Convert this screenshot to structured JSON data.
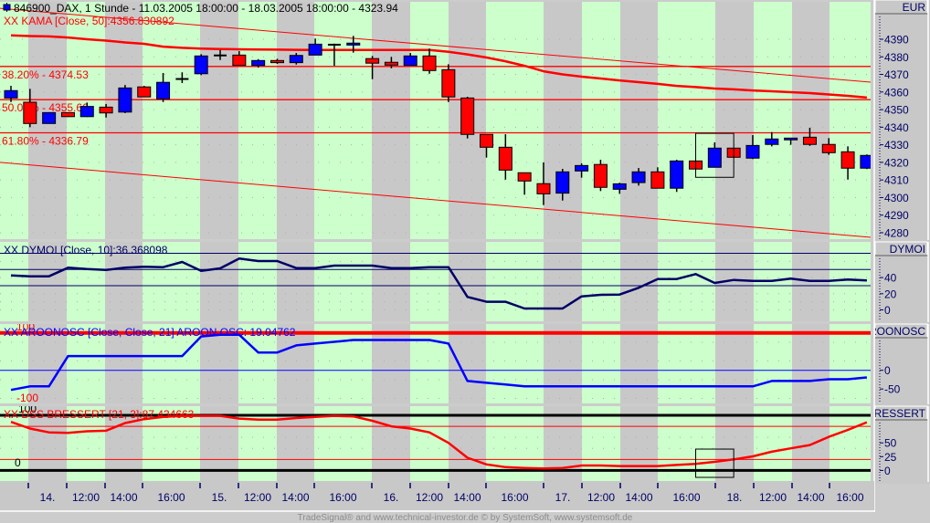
{
  "header": {
    "title": "846900_DAX, 1 Stunde - 11.03.2005 18:00:00 - 18.03.2005 18:00:00 - 4323.94",
    "icon": "candlestick-square-icon"
  },
  "footer": "TradeSignal® and www.technical-investor.de © by SystemSoft, www.systemsoft.de",
  "colors": {
    "up": "#0000ff",
    "down": "#ff0000",
    "doji": "#000000",
    "band_green": "#ccffcc",
    "band_gray": "#c8c8c8",
    "axis_text": "#000066",
    "kama": "#ff0000",
    "dymoi": "#000066",
    "aroon": "#0000ff",
    "dss": "#ff0000"
  },
  "x_axis": {
    "tick_labels": [
      "14.",
      "12:00",
      "14:00",
      "16:00",
      "15.",
      "12:00",
      "14:00",
      "16:00",
      "16.",
      "12:00",
      "14:00",
      "16:00",
      "17.",
      "12:00",
      "14:00",
      "16:00",
      "18.",
      "12:00",
      "14:00",
      "16:00"
    ]
  },
  "chart_data": [
    {
      "type": "candlestick",
      "axis_label": "EUR",
      "yticks": [
        4390,
        4380,
        4370,
        4360,
        4350,
        4340,
        4330,
        4320,
        4310,
        4300,
        4290,
        4280
      ],
      "ylim": [
        4270,
        4415
      ],
      "open": [
        4356.6,
        4354.2,
        4342.1,
        4348.3,
        4346.0,
        4351.4,
        4348.6,
        4362.9,
        4356.1,
        4367.4,
        4370.4,
        4380.8,
        4381.0,
        4375.1,
        4377.9,
        4376.7,
        4381.0,
        4386.9,
        4386.7,
        4379.0,
        4376.9,
        4375.1,
        4380.5,
        4372.7,
        4356.6,
        4335.9,
        4328.6,
        4314.1,
        4307.9,
        4302.5,
        4315.1,
        4318.8,
        4304.7,
        4308.5,
        4314.6,
        4305.3,
        4320.8,
        4317.2,
        4328.1,
        4322.4,
        4330.2,
        4332.8,
        4334.3,
        4330.2,
        4326.0,
        4316.7
      ],
      "high": [
        4363.5,
        4361.8,
        4348.5,
        4348.5,
        4354.0,
        4353.2,
        4364.0,
        4363.5,
        4370.8,
        4371.2,
        4381.5,
        4383.8,
        4383.3,
        4378.7,
        4378.9,
        4382.2,
        4390.4,
        4387.5,
        4391.9,
        4380.5,
        4380.0,
        4382.2,
        4384.7,
        4375.8,
        4357.3,
        4335.9,
        4336.0,
        4314.1,
        4320.0,
        4316.3,
        4319.4,
        4321.5,
        4308.4,
        4316.8,
        4317.2,
        4321.5,
        4320.8,
        4331.4,
        4328.1,
        4335.5,
        4337.2,
        4333.8,
        4339.7,
        4333.8,
        4329.1,
        4324.5
      ],
      "low": [
        4354.3,
        4340.0,
        4342.0,
        4345.8,
        4345.8,
        4345.5,
        4348.0,
        4357.0,
        4354.3,
        4365.1,
        4369.6,
        4378.2,
        4375.0,
        4373.9,
        4376.0,
        4375.6,
        4381.0,
        4374.9,
        4382.4,
        4367.3,
        4373.5,
        4375.0,
        4370.4,
        4354.3,
        4333.6,
        4322.7,
        4310.2,
        4301.6,
        4295.7,
        4298.3,
        4311.3,
        4303.7,
        4302.1,
        4306.8,
        4305.3,
        4303.2,
        4316.2,
        4317.2,
        4322.9,
        4321.9,
        4329.1,
        4330.0,
        4329.4,
        4324.3,
        4310.2,
        4316.2
      ],
      "close": [
        4360.8,
        4342.1,
        4348.3,
        4346.0,
        4351.8,
        4348.1,
        4362.3,
        4357.2,
        4365.5,
        4367.4,
        4380.5,
        4380.8,
        4375.1,
        4377.9,
        4376.7,
        4380.8,
        4387.2,
        4386.9,
        4387.8,
        4376.4,
        4375.3,
        4380.5,
        4372.2,
        4357.2,
        4335.9,
        4328.6,
        4315.6,
        4309.4,
        4302.1,
        4314.6,
        4318.2,
        4305.8,
        4307.8,
        4314.6,
        4305.3,
        4320.8,
        4316.2,
        4328.1,
        4322.9,
        4329.6,
        4333.3,
        4333.8,
        4330.2,
        4325.5,
        4316.7,
        4323.94
      ],
      "kama": {
        "label": "XX KAMA [Close, 50]:4356.830892",
        "values": [
          4392.2,
          4391.8,
          4391.6,
          4391.0,
          4390.0,
          4389.2,
          4388.2,
          4387.4,
          4385.8,
          4385.1,
          4384.7,
          4384.4,
          4384.3,
          4384.2,
          4384.1,
          4384.0,
          4383.9,
          4383.9,
          4383.9,
          4383.9,
          4383.9,
          4383.9,
          4383.9,
          4382.9,
          4381.4,
          4379.6,
          4377.5,
          4374.9,
          4371.8,
          4370.0,
          4368.7,
          4367.7,
          4366.6,
          4365.6,
          4364.6,
          4363.5,
          4362.8,
          4362.0,
          4361.5,
          4360.9,
          4360.4,
          4359.9,
          4359.4,
          4358.6,
          4357.8,
          4356.83
        ]
      },
      "fib_levels": [
        {
          "label": "38.20% - 4374.53",
          "value": 4374.53
        },
        {
          "label": "50.00% - 4355.66",
          "value": 4355.66
        },
        {
          "label": "61.80% - 4336.79",
          "value": 4336.79
        }
      ],
      "trendlines": [
        {
          "start": 4407.6,
          "end": 4365.6
        },
        {
          "start": 4320.0,
          "end": 4277.4
        }
      ],
      "highlight": {
        "from_bar": 36,
        "to_bar": 38,
        "high": 4336.5,
        "low": 4311.5
      }
    },
    {
      "type": "line",
      "label": "XX DYMOI [Close, 10]:36.368098",
      "axis_label": "DYMOI",
      "yticks": [
        40,
        20,
        0
      ],
      "reference_lines": [
        70,
        50,
        30
      ],
      "values": [
        42.7,
        41.6,
        41.6,
        52.2,
        50.5,
        49.5,
        52.2,
        53.3,
        52.9,
        59.3,
        48.4,
        51.4,
        63.5,
        60.5,
        60.5,
        51.8,
        51.8,
        54.8,
        54.8,
        54.8,
        51.8,
        51.8,
        52.9,
        52.9,
        16.0,
        10.0,
        10.0,
        1.7,
        1.7,
        1.7,
        16.7,
        18.6,
        19.0,
        27.3,
        38.2,
        38.2,
        44.3,
        33.3,
        37.1,
        35.9,
        35.9,
        38.6,
        35.9,
        35.9,
        37.5,
        36.37
      ]
    },
    {
      "type": "line",
      "label": "XX AROONOSC [Close, Close, 21] AROON OSC: 19.04762",
      "axis_label": "AROONOSC",
      "yticks": [
        0,
        -50
      ],
      "range_labels": [
        "100",
        "-100"
      ],
      "reference_lines": [
        100,
        0
      ],
      "values": [
        -52.4,
        -42.9,
        -42.9,
        38.1,
        38.1,
        38.1,
        38.1,
        38.1,
        38.1,
        38.1,
        90.5,
        95.2,
        95.2,
        47.6,
        47.6,
        66.7,
        71.4,
        76.2,
        81.0,
        81.0,
        81.0,
        81.0,
        81.0,
        71.4,
        -28.6,
        -33.3,
        -38.1,
        -42.9,
        -42.9,
        -42.9,
        -42.9,
        -42.9,
        -42.9,
        -42.9,
        -42.9,
        -42.9,
        -42.9,
        -42.9,
        -42.9,
        -42.9,
        -28.6,
        -28.6,
        -28.6,
        -23.8,
        -23.8,
        -19.05
      ]
    },
    {
      "type": "line",
      "label": "XX DSS BRESSERT [21, 3]:87.434663",
      "axis_label": "DSS BRESSERT",
      "yticks": [
        50,
        25,
        0
      ],
      "range_labels": [
        "100",
        "0"
      ],
      "bound_lines": [
        100,
        0
      ],
      "reference_lines": [
        80,
        20
      ],
      "values": [
        88,
        76,
        69,
        68,
        71,
        72,
        86,
        93,
        97,
        99,
        99,
        99,
        94,
        92,
        92,
        95,
        97,
        99,
        98,
        90,
        80,
        76,
        69,
        50,
        23,
        11,
        6,
        4.5,
        3.5,
        4.5,
        9,
        9,
        8,
        8,
        8,
        10,
        12,
        15.6,
        20,
        25.5,
        34,
        40,
        46,
        61,
        73.5,
        87.43
      ],
      "highlight": {
        "from_bar": 36,
        "to_bar": 38,
        "high": 38.7,
        "low": -12.6
      }
    }
  ]
}
